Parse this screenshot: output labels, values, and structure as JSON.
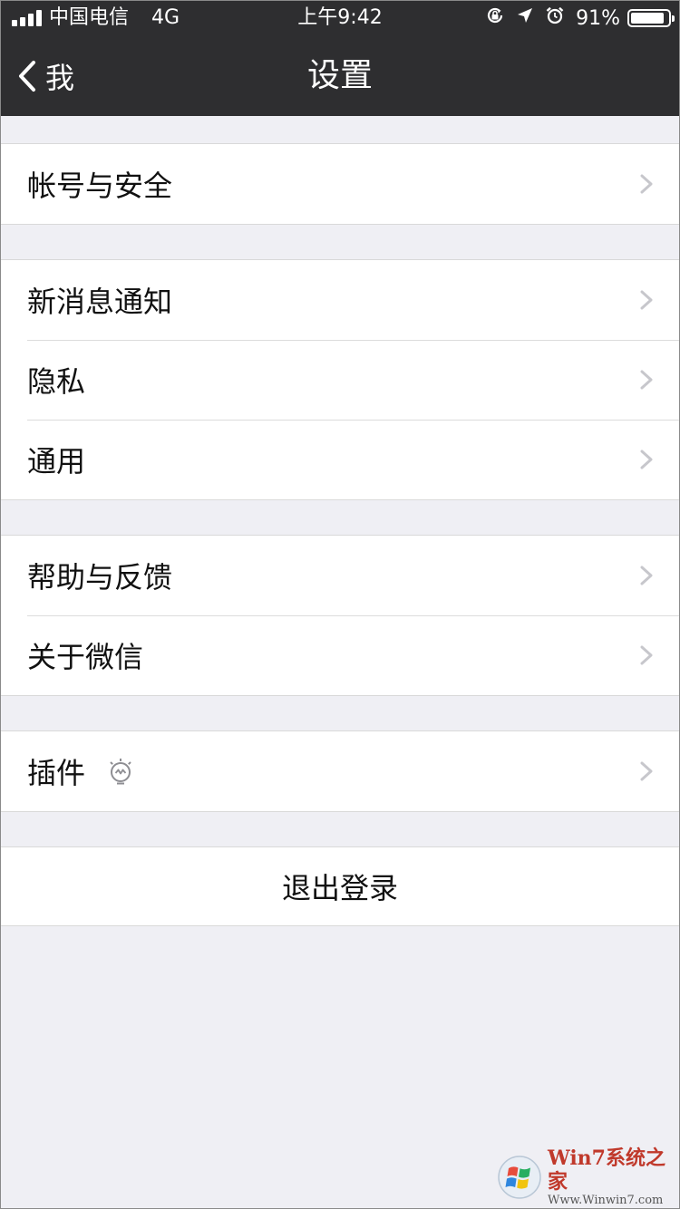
{
  "status_bar": {
    "carrier": "中国电信",
    "network": "4G",
    "time": "上午9:42",
    "battery_percent": "91%",
    "battery_level": 0.91
  },
  "nav": {
    "back_label": "我",
    "title": "设置"
  },
  "groups": [
    {
      "items": [
        "帐号与安全"
      ]
    },
    {
      "items": [
        "新消息通知",
        "隐私",
        "通用"
      ]
    },
    {
      "items": [
        "帮助与反馈",
        "关于微信"
      ]
    },
    {
      "items": [
        "插件"
      ]
    }
  ],
  "logout_label": "退出登录",
  "watermark": {
    "title": "Win7系统之家",
    "url": "Www.Winwin7.com"
  },
  "colors": {
    "nav_background": "#2e2e30",
    "page_background": "#efeff4",
    "row_background": "#ffffff",
    "chevron": "#c7c7cc"
  },
  "icons": {
    "back": "chevron-left-icon",
    "row_arrow": "chevron-right-icon",
    "plugin": "lightbulb-icon",
    "status": [
      "signal-icon",
      "rotation-lock-icon",
      "location-arrow-icon",
      "alarm-icon",
      "battery-icon"
    ]
  }
}
